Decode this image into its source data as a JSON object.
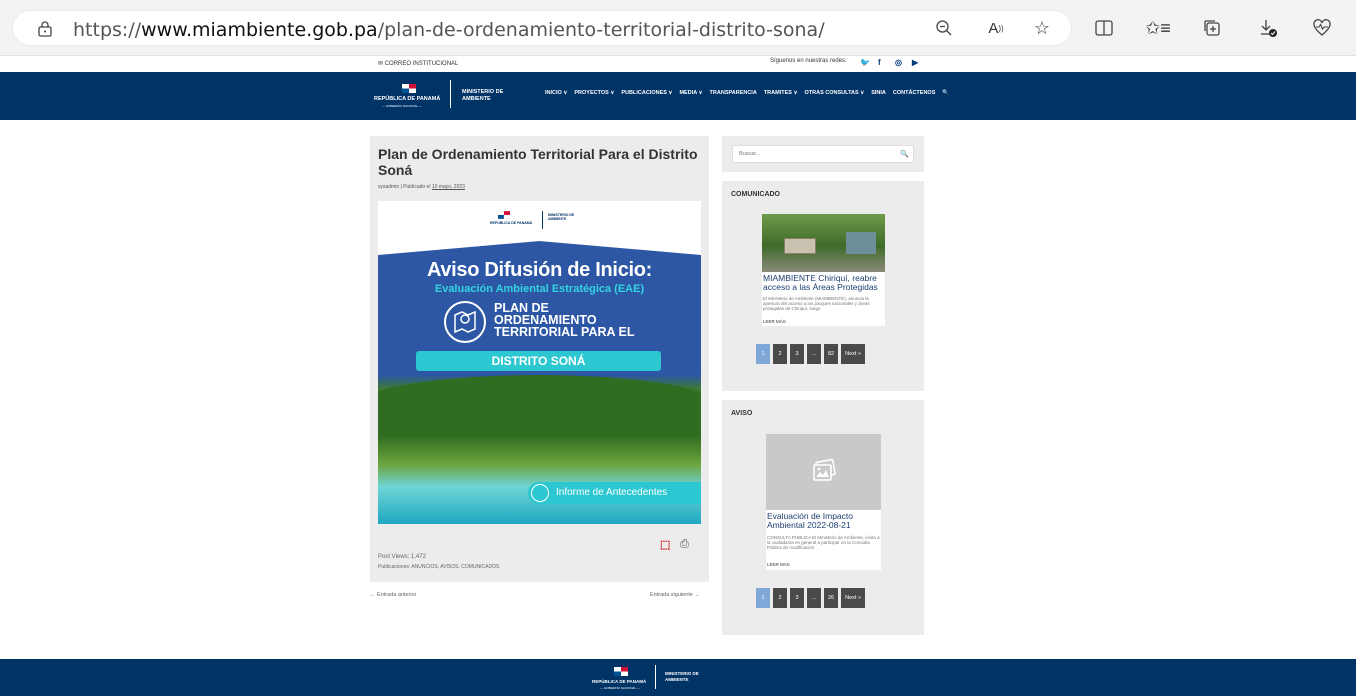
{
  "browser": {
    "url_prefix": "https://",
    "url_host": "www.miambiente.gob.pa",
    "url_path": "/plan-de-ordenamiento-territorial-distrito-sona/"
  },
  "topbar": {
    "mail_label": "✉ CORREO INSTITUCIONAL",
    "follow_label": "Síguenos en nuestras redes:"
  },
  "header": {
    "republic": "REPÚBLICA DE PANAMÁ",
    "gobierno": "— GOBIERNO NACIONAL —",
    "ministerio_line1": "MINISTERIO DE",
    "ministerio_line2": "AMBIENTE",
    "nav": [
      "INICIO ∨",
      "PROYECTOS ∨",
      "PUBLICACIONES ∨",
      "MEDIA ∨",
      "TRANSPARENCIA",
      "TRAMITES ∨",
      "OTRAS CONSULTAS ∨",
      "SINIA",
      "CONTÁCTENOS",
      "🔍"
    ]
  },
  "article": {
    "title": "Plan de Ordenamiento Territorial Para el Distrito Soná",
    "meta_author": "sysadmin | Publicado el ",
    "meta_date": "10 mayo, 2023",
    "poster": {
      "republic": "REPÚBLICA DE PANAMÁ",
      "ministerio": "MINISTERIO DE AMBIENTE",
      "heading": "Aviso Difusión de Inicio:",
      "subheading": "Evaluación Ambiental Estratégica (EAE)",
      "plan_line1": "PLAN DE",
      "plan_line2": "ORDENAMIENTO",
      "plan_line3": "TERRITORIAL PARA EL",
      "banner": "DISTRITO SONÁ",
      "informe": "Informe de Antecedentes"
    },
    "views": "Post Views: 1,472",
    "categories": "Publicaciones: ANUNCIOS, AVISOS, COMUNICADOS",
    "prev": "← Entrada anterior",
    "next": "Entrada siguiente →"
  },
  "sidebar": {
    "search_placeholder": "Buscar...",
    "comunicado": {
      "title": "COMUNICADO",
      "card_title": "MIAMBIENTE Chiriquí, reabre acceso a las Áreas Protegidas",
      "card_text": "El Ministerio de Ambiente (MiAMBIENTE), anuncia la apertura del acceso a los parques nacionales y áreas protegidas de Chiriquí, luego",
      "more": "LEER MÁS",
      "pages": [
        "1",
        "2",
        "3",
        "...",
        "82",
        "Next »"
      ]
    },
    "aviso": {
      "title": "AVISO",
      "card_title": "Evaluación de Impacto Ambiental 2022-08-21",
      "card_text": "CONSULTA PÚBLICA El Ministerio de Ambiente, invita a la ciudadanía en general a participar en la Consulta Pública de modificación",
      "more": "LEER MÁS",
      "pages": [
        "1",
        "2",
        "3",
        "...",
        "26",
        "Next »"
      ]
    }
  },
  "colors": {
    "header_bg": "#003366",
    "pager_active": "#7fa7d8",
    "pager": "#4a4a4a"
  }
}
